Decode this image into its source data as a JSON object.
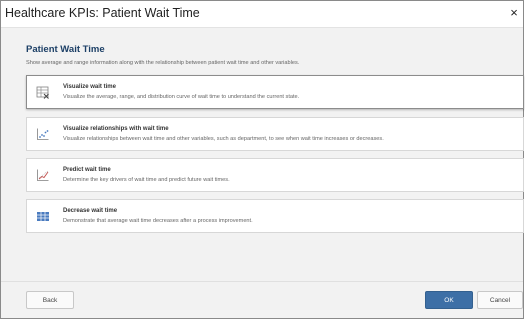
{
  "window": {
    "title": "Healthcare KPIs: Patient Wait Time",
    "close_label": "×"
  },
  "header": {
    "title": "Patient Wait Time",
    "subtitle": "Show average and range information along with the relationship between patient wait time and other variables."
  },
  "options": [
    {
      "title": "Visualize wait time",
      "description": "Visualize the average, range, and distribution curve of wait time to understand the current state.",
      "icon": "table-icon",
      "selected": true
    },
    {
      "title": "Visualize relationships with wait time",
      "description": "Visualize relationships between wait time and other variables, such as department, to see when wait time increases or decreases.",
      "icon": "scatter-chart-icon",
      "selected": false
    },
    {
      "title": "Predict wait time",
      "description": "Determine the key drivers of wait time and predict future wait times.",
      "icon": "trend-chart-icon",
      "selected": false
    },
    {
      "title": "Decrease wait time",
      "description": "Demonstrate that average wait time decreases after a process improvement.",
      "icon": "grid-icon",
      "selected": false
    }
  ],
  "footer": {
    "back_label": "Back",
    "ok_label": "OK",
    "cancel_label": "Cancel"
  },
  "colors": {
    "accent": "#3d6fa6",
    "heading": "#1c3f66",
    "icon_blue": "#4a7bbf",
    "icon_red": "#c0504d"
  }
}
